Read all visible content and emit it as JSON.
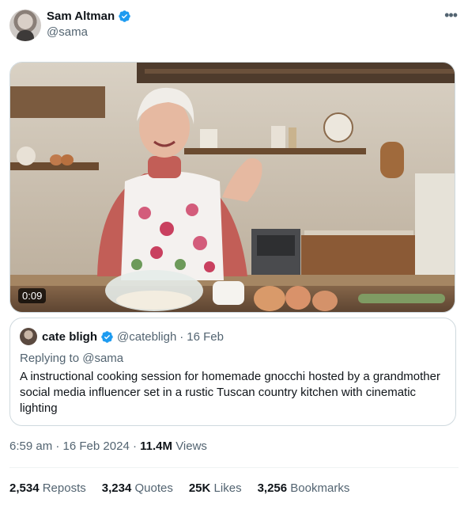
{
  "author": {
    "display_name": "Sam Altman",
    "handle": "@sama",
    "verified": true
  },
  "more_icon": "ellipsis-icon",
  "video": {
    "duration": "0:09",
    "kind": "video thumbnail"
  },
  "quoted_post": {
    "display_name": "cate bligh",
    "handle": "@catebligh",
    "separator": "·",
    "date": "16 Feb",
    "replying_to_label": "Replying to",
    "replying_to_handle": "@sama",
    "text": "A instructional cooking session for homemade gnocchi hosted by a grandmother social media influencer set in a rustic Tuscan country kitchen with cinematic lighting"
  },
  "timestamp": {
    "time": "6:59 am",
    "sep1": "·",
    "date": "16 Feb 2024",
    "sep2": "·",
    "views_count": "11.4M",
    "views_label": "Views"
  },
  "stats": [
    {
      "num": "2,534",
      "label": "Reposts"
    },
    {
      "num": "3,234",
      "label": "Quotes"
    },
    {
      "num": "25K",
      "label": "Likes"
    },
    {
      "num": "3,256",
      "label": "Bookmarks"
    }
  ],
  "colors": {
    "verified_blue": "#1d9bf0",
    "text_primary": "#0f1419",
    "text_secondary": "#536471",
    "border": "#cfd9de"
  }
}
